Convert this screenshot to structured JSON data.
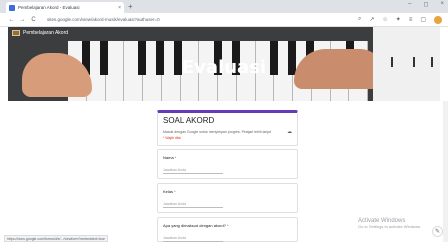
{
  "browser": {
    "tab_title": "Pembelajaran Akord - Evaluasi",
    "tab_close": "×",
    "new_tab": "+",
    "win_minimize": "–",
    "win_maximize": "◻",
    "win_close": "×",
    "back": "←",
    "forward": "→",
    "reload": "C",
    "url": "sites.google.com/view/akord-musik/evaluasi?authuser=0",
    "icons": [
      "zoom-icon",
      "share-icon",
      "star-icon",
      "extensions-icon",
      "reading-list-icon",
      "window-icon",
      "profile-avatar"
    ]
  },
  "banner": {
    "brand_name": "Pembelajaran Akord",
    "title": "Evaluasi"
  },
  "form": {
    "title": "SOAL AKORD",
    "account_text": "Masuk dengan Google untuk menyimpan progres. Pelajari lebih lanjut",
    "required_note": "* Wajib diisi",
    "questions": [
      {
        "label": "Nama",
        "required": "*",
        "placeholder": "Jawaban Anda"
      },
      {
        "label": "Kelas",
        "required": "*",
        "placeholder": "Jawaban Anda"
      },
      {
        "label": "Apa yang dimaksud dengan akord?",
        "required": "*",
        "placeholder": "Jawaban Anda"
      }
    ]
  },
  "status_url": "https://docs.google.com/forms/d/e/.../viewform?embedded=true",
  "watermark": {
    "title": "Activate Windows",
    "subtitle": "Go to Settings to activate Windows."
  },
  "colors": {
    "accent": "#673ab7",
    "banner_bg": "#3b3d3f",
    "required": "#d93025"
  }
}
